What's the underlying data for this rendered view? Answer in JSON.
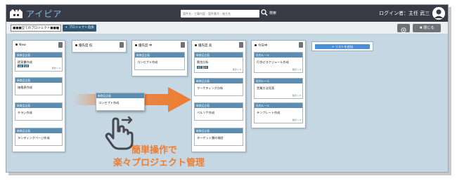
{
  "app": {
    "title": "アイピア"
  },
  "search": {
    "placeholder": "案件名・工事内容・案件番号・施主名",
    "label": "検索"
  },
  "user": {
    "login_label": "ログイン者：主任 武三"
  },
  "toolbar": {
    "project_select": "■■■全てのプロジェクト■■■",
    "add_project_label": "+ プロジェクト追加",
    "close_label": "✖ 閉じる"
  },
  "columns": [
    {
      "title": "New",
      "cards": [
        {
          "header": "新商品企画",
          "title": "提案書作成",
          "tags": [
            "議事",
            "佐藤"
          ],
          "meta": "集計 ▷ 0"
        },
        {
          "header": "新商品企画",
          "title": "価格表作成",
          "tags": [],
          "meta": ""
        },
        {
          "header": "新商品企画",
          "title": "チラシ作成",
          "tags": [],
          "meta": ""
        },
        {
          "header": "新商品企画",
          "title": "ランディングページ作成",
          "tags": [],
          "meta": ""
        }
      ]
    },
    {
      "title": "優先度 低",
      "cards": []
    },
    {
      "title": "優先度 中",
      "cards": [
        {
          "header": "新商品企画",
          "title": "コンセプト作成",
          "tags": [],
          "meta": ""
        }
      ]
    },
    {
      "title": "優先度 高",
      "cards": [
        {
          "header": "新商品企画",
          "title": "競合分析",
          "tags": [
            "未定",
            "鈴木"
          ],
          "meta": "集計 ▷ 0"
        },
        {
          "header": "新商品企画",
          "title": "マーケティング分析",
          "tags": [],
          "meta": ""
        },
        {
          "header": "新商品企画",
          "title": "ペルソナ作成",
          "tags": [],
          "meta": ""
        },
        {
          "header": "新商品企画",
          "title": "ターゲット層の検討",
          "tags": [],
          "meta": ""
        }
      ]
    },
    {
      "title": "今日中",
      "cards": [
        {
          "header": "社内ルール",
          "title": "打合せスケジュール作成",
          "tags": [],
          "meta": "集計 ▷ 0"
        },
        {
          "header": "社内ルール",
          "title": "営業方法見直",
          "tags": [],
          "meta": "集計 ▷ 0"
        },
        {
          "header": "社内ルール",
          "title": "テンプレート作成",
          "tags": [],
          "meta": "集計 ▷ 0"
        }
      ]
    }
  ],
  "add_list": {
    "label": "+ リストを追加"
  },
  "floating_card": {
    "header": "新商品企画",
    "title": "コンセプト作成"
  },
  "promo": {
    "line1": "簡単操作で",
    "line2": "楽々プロジェクト管理"
  },
  "colors": {
    "accent": "#ed7d31",
    "topbar": "#383b45",
    "card_header": "#5a8db1",
    "background": "#c5d7e2"
  }
}
